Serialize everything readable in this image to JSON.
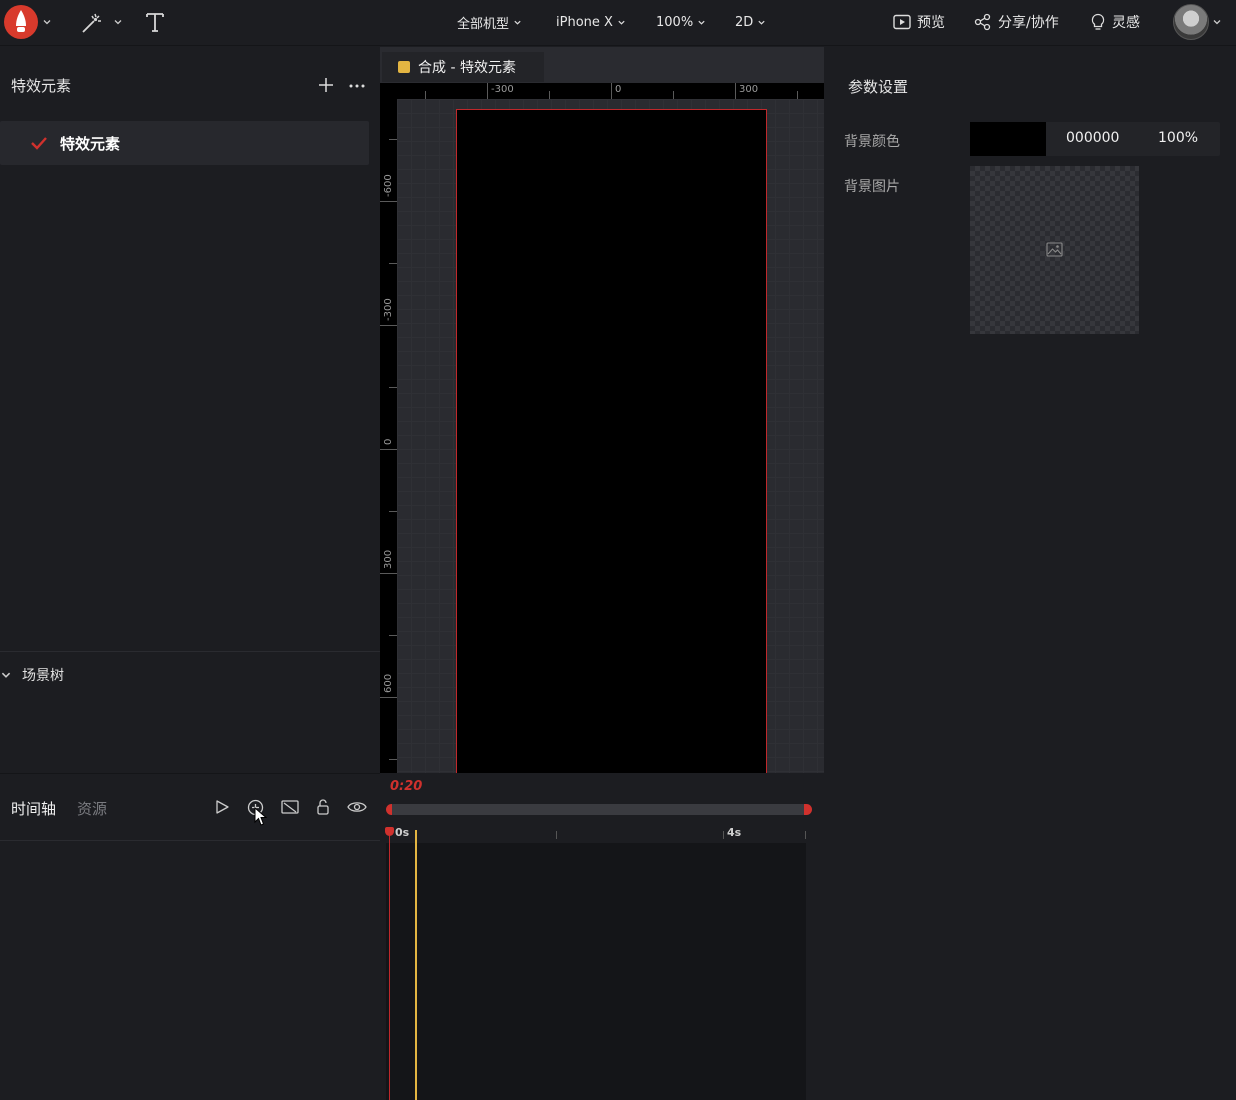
{
  "topbar": {
    "menus": [
      {
        "label": "全部机型"
      },
      {
        "label": "iPhone X"
      },
      {
        "label": "100%"
      },
      {
        "label": "2D"
      }
    ],
    "preview_label": "预览",
    "share_label": "分享/协作",
    "inspiration_label": "灵感"
  },
  "left_panel": {
    "title": "特效元素",
    "layers": [
      {
        "label": "特效元素",
        "checked": true
      }
    ],
    "scene_tree_label": "场景树"
  },
  "canvas": {
    "tab_label": "合成 - 特效元素",
    "ruler_h_labels": [
      "-300",
      "0",
      "300"
    ],
    "ruler_v_labels": [
      "-600",
      "-300",
      "0",
      "300",
      "600"
    ]
  },
  "properties": {
    "title": "参数设置",
    "bg_color_label": "背景颜色",
    "bg_color_hex": "000000",
    "bg_color_alpha": "100%",
    "bg_image_label": "背景图片"
  },
  "timeline": {
    "tab_timeline": "时间轴",
    "tab_assets": "资源",
    "current_time": "0:20",
    "ticks": [
      "0s",
      "4s"
    ]
  },
  "colors": {
    "accent": "#d0312d",
    "tab_dot": "#e3b542",
    "background": "#1c1d21"
  }
}
